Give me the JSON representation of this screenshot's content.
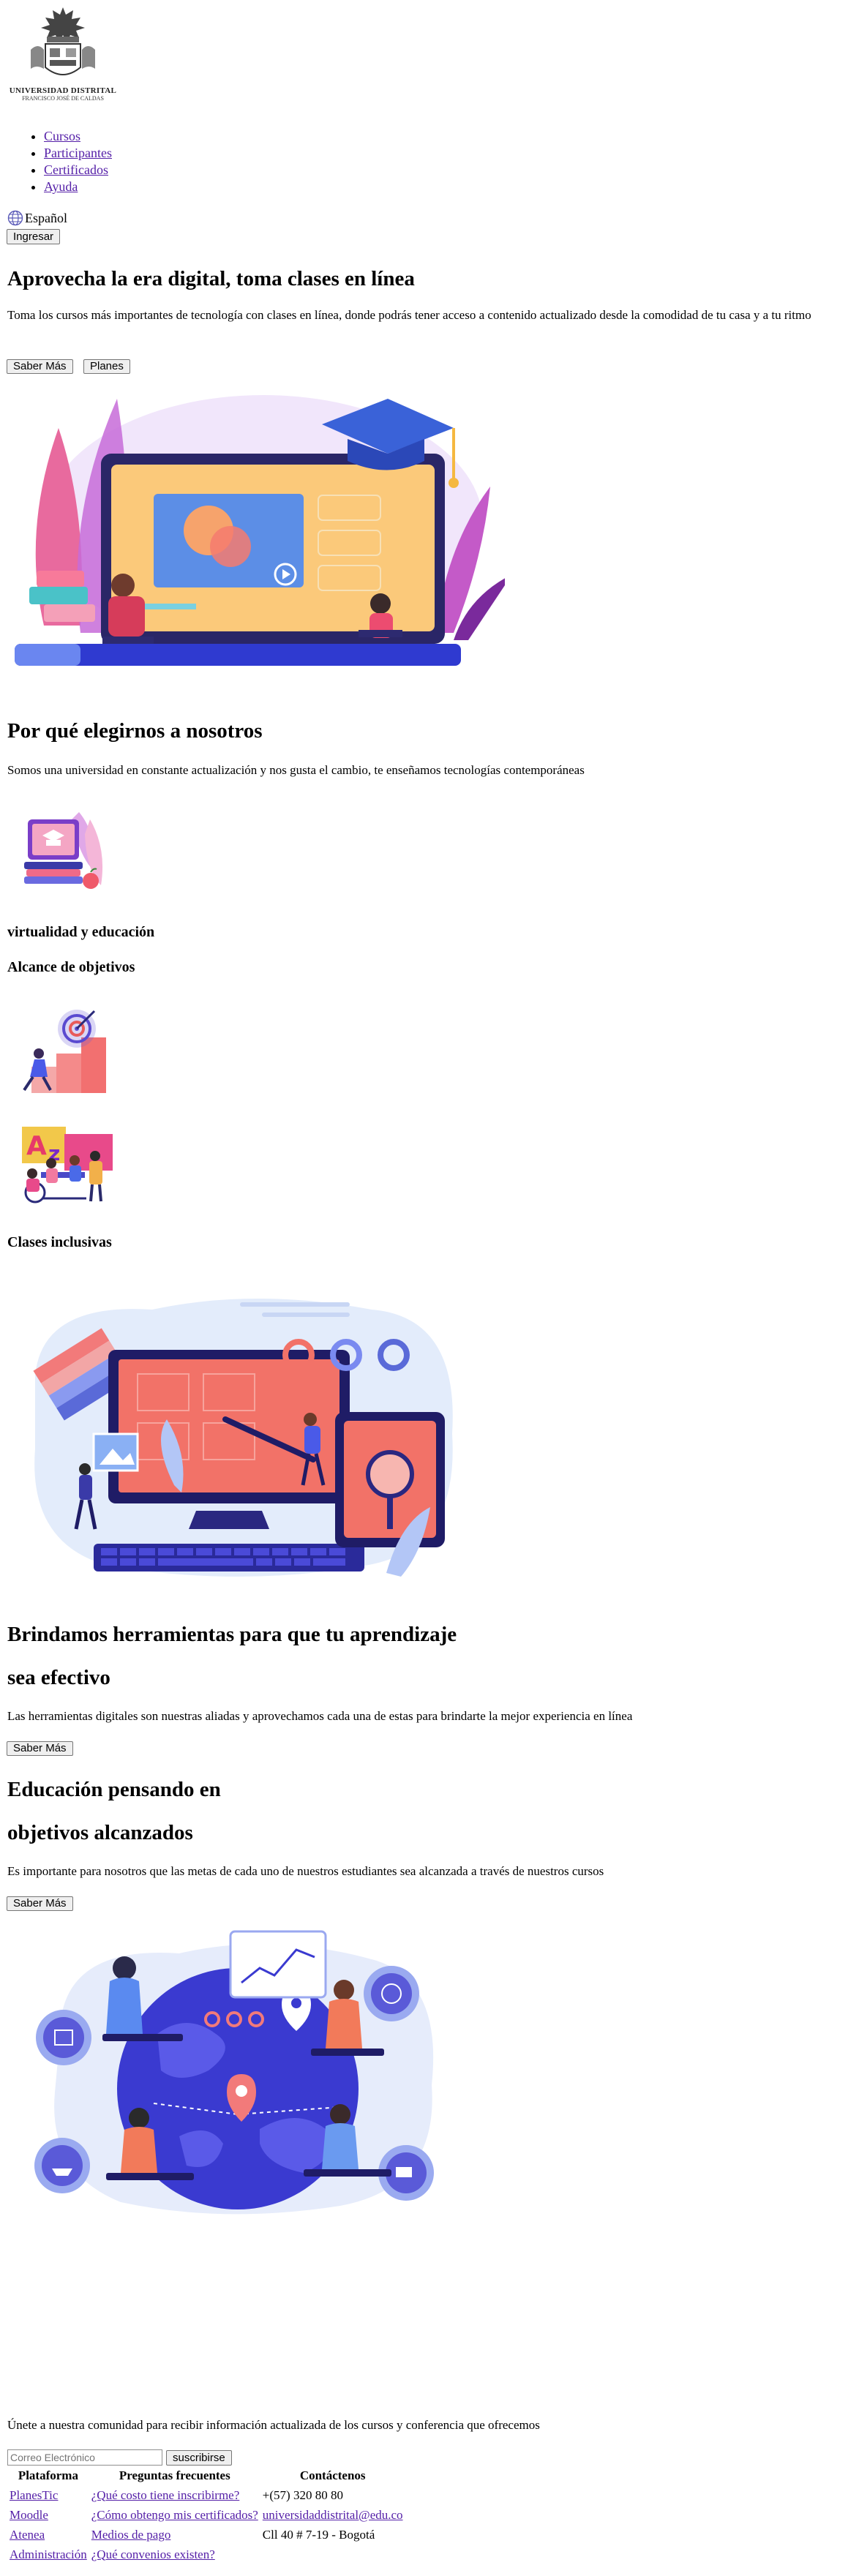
{
  "header": {
    "logo_line1": "UNIVERSIDAD DISTRITAL",
    "logo_line2": "FRANCISCO JOSÉ DE CALDAS",
    "nav": [
      "Cursos",
      "Participantes",
      "Certificados",
      "Ayuda"
    ],
    "language": "Español",
    "login": "Ingresar"
  },
  "hero": {
    "title": "Aprovecha la era digital, toma clases en línea",
    "text": "Toma los cursos más importantes de tecnología con clases en línea, donde podrás tener acceso a contenido actualizado desde la comodidad de tu casa y a tu ritmo",
    "btn_more": "Saber Más",
    "btn_plans": "Planes"
  },
  "why": {
    "title": "Por qué elegirnos a nosotros",
    "text": "Somos una universidad en constante actualización y nos gusta el cambio, te enseñamos tecnologías contemporáneas",
    "feature1": "virtualidad y educación",
    "feature2": "Alcance de objetivos",
    "feature3": "Clases inclusivas"
  },
  "tools": {
    "title1": "Brindamos herramientas para que tu aprendizaje",
    "title2": "sea efectivo",
    "text": "Las herramientas digitales son nuestras aliadas y aprovechamos cada una de estas para brindarte la mejor experiencia en línea",
    "btn": "Saber Más"
  },
  "goals": {
    "title1": "Educación pensando en",
    "title2": "objetivos alcanzados",
    "text": "Es importante para nosotros que las metas de cada uno de nuestros estudiantes sea alcanzada a través de nuestros cursos",
    "btn": "Saber Más"
  },
  "newsletter": {
    "text": "Únete a nuestra comunidad para recibir información actualizada de los cursos y conferencia que ofrecemos",
    "placeholder": "Correo Electrónico",
    "btn": "suscribirse"
  },
  "footer": {
    "headers": [
      "Plataforma",
      "Preguntas frecuentes",
      "Contáctenos"
    ],
    "platform": [
      "PlanesTic",
      "Moodle",
      "Atenea",
      "Administración"
    ],
    "faq": [
      "¿Qué costo tiene inscribirme?",
      "¿Cómo obtengo mis certificados?",
      "Medios de pago",
      "¿Qué convenios existen?"
    ],
    "contact_phone": "+(57) 320 80 80",
    "contact_email": "universidaddistrital@edu.co",
    "contact_address": "Cll 40 # 7-19 - Bogotá"
  },
  "colors": {
    "link": "#5520a8",
    "illustration_purple": "#6b5bd6",
    "illustration_coral": "#f07070",
    "illustration_navy": "#1e1b6e"
  }
}
